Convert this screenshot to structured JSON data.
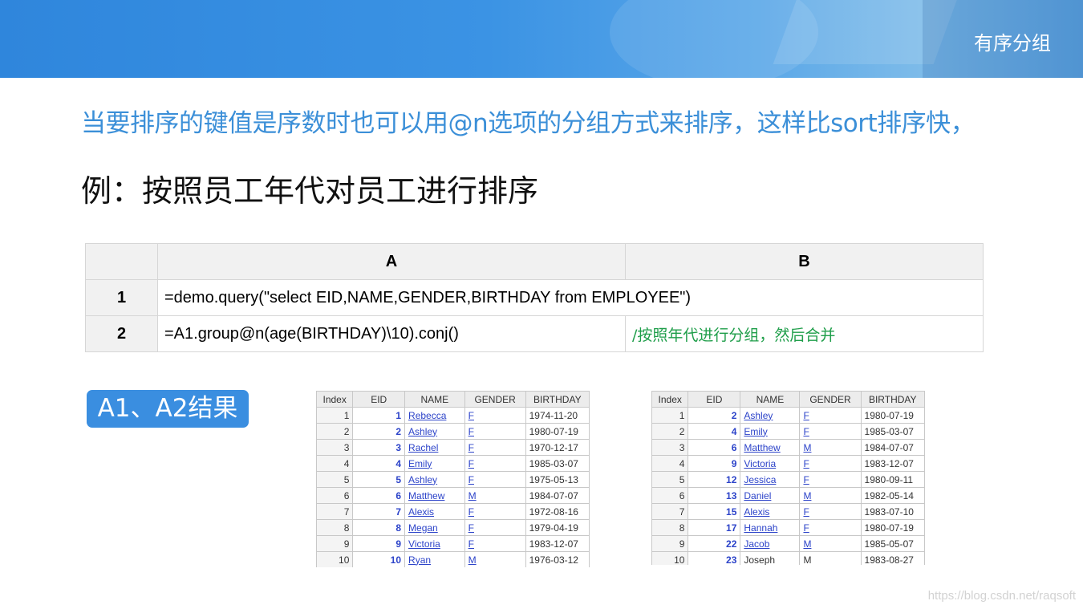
{
  "header": {
    "title": "有序分组"
  },
  "intro": "当要排序的键值是序数时也可以用@n选项的分组方式来排序，这样比sort排序快，",
  "example": "例：按照员工年代对员工进行排序",
  "grid": {
    "col_a": "A",
    "col_b": "B",
    "rows": [
      {
        "num": "1",
        "a": "=demo.query(\"select  EID,NAME,GENDER,BIRTHDAY  from EMPLOYEE\")",
        "b": ""
      },
      {
        "num": "2",
        "a": "=A1.group@n(age(BIRTHDAY)\\10).conj()",
        "b": "/按照年代进行分组，然后合并"
      }
    ]
  },
  "result_badge": "A1、A2结果",
  "result_columns": [
    "Index",
    "EID",
    "NAME",
    "GENDER",
    "BIRTHDAY"
  ],
  "table_a1": [
    [
      "1",
      "1",
      "Rebecca",
      "F",
      "1974-11-20"
    ],
    [
      "2",
      "2",
      "Ashley",
      "F",
      "1980-07-19"
    ],
    [
      "3",
      "3",
      "Rachel",
      "F",
      "1970-12-17"
    ],
    [
      "4",
      "4",
      "Emily",
      "F",
      "1985-03-07"
    ],
    [
      "5",
      "5",
      "Ashley",
      "F",
      "1975-05-13"
    ],
    [
      "6",
      "6",
      "Matthew",
      "M",
      "1984-07-07"
    ],
    [
      "7",
      "7",
      "Alexis",
      "F",
      "1972-08-16"
    ],
    [
      "8",
      "8",
      "Megan",
      "F",
      "1979-04-19"
    ],
    [
      "9",
      "9",
      "Victoria",
      "F",
      "1983-12-07"
    ],
    [
      "10",
      "10",
      "Ryan",
      "M",
      "1976-03-12"
    ]
  ],
  "table_a2": [
    [
      "1",
      "2",
      "Ashley",
      "F",
      "1980-07-19"
    ],
    [
      "2",
      "4",
      "Emily",
      "F",
      "1985-03-07"
    ],
    [
      "3",
      "6",
      "Matthew",
      "M",
      "1984-07-07"
    ],
    [
      "4",
      "9",
      "Victoria",
      "F",
      "1983-12-07"
    ],
    [
      "5",
      "12",
      "Jessica",
      "F",
      "1980-09-11"
    ],
    [
      "6",
      "13",
      "Daniel",
      "M",
      "1982-05-14"
    ],
    [
      "7",
      "15",
      "Alexis",
      "F",
      "1983-07-10"
    ],
    [
      "8",
      "17",
      "Hannah",
      "F",
      "1980-07-19"
    ],
    [
      "9",
      "22",
      "Jacob",
      "M",
      "1985-05-07"
    ],
    [
      "10",
      "23",
      "Joseph",
      "M",
      "1983-08-27"
    ]
  ],
  "watermark": "https://blog.csdn.net/raqsoft"
}
